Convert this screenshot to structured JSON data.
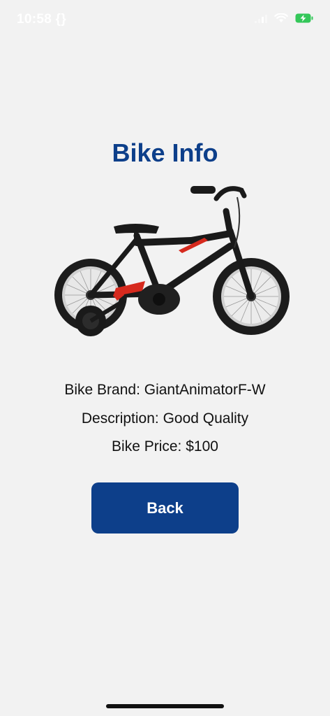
{
  "status_bar": {
    "time": "10:58 {}"
  },
  "page": {
    "title": "Bike Info"
  },
  "bike": {
    "image_icon": "bike-photo",
    "brand_line": "Bike Brand: GiantAnimatorF-W",
    "description_line": "Description: Good Quality",
    "price_line": "Bike Price: $100"
  },
  "actions": {
    "back_label": "Back"
  },
  "colors": {
    "accent": "#0d3f8a",
    "background": "#f2f2f2",
    "bike_frame": "#1a1a1a",
    "bike_stripe": "#d62a1e",
    "battery": "#34c759"
  }
}
